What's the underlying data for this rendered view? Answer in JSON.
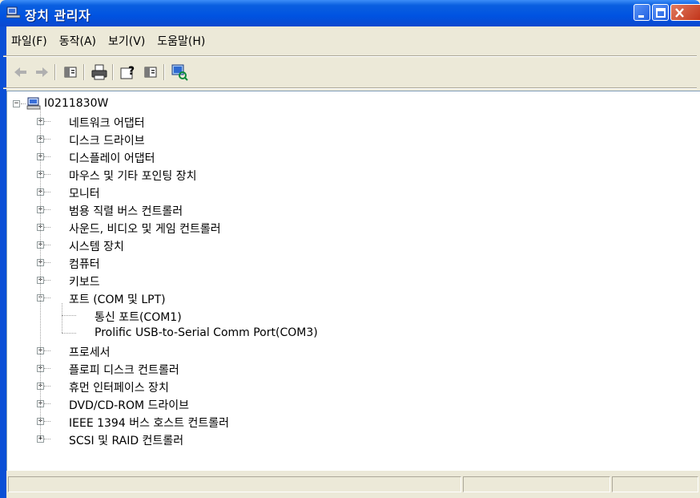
{
  "window": {
    "title": "장치 관리자"
  },
  "menu": [
    {
      "label": "파일(F)",
      "accel": "F"
    },
    {
      "label": "동작(A)",
      "accel": "A"
    },
    {
      "label": "보기(V)",
      "accel": "V"
    },
    {
      "label": "도움말(H)",
      "accel": "H"
    }
  ],
  "menu_labels": {
    "file": "파일(F)",
    "action": "동작(A)",
    "view": "보기(V)",
    "help": "도움말(H)"
  },
  "toolbar": {
    "icons": [
      "back-icon",
      "forward-icon",
      "show-hide-tree-icon",
      "print-icon",
      "help-icon",
      "properties-icon",
      "scan-hardware-icon"
    ]
  },
  "tree": {
    "root": {
      "label": "I0211830W",
      "icon": "computer-icon",
      "expanded": true
    },
    "categories": [
      {
        "label": "네트워크 어댑터",
        "icon": "network-adapter-icon",
        "expanded": false
      },
      {
        "label": "디스크 드라이브",
        "icon": "disk-drive-icon",
        "expanded": false
      },
      {
        "label": "디스플레이 어댑터",
        "icon": "display-adapter-icon",
        "expanded": false
      },
      {
        "label": "마우스 및 기타 포인팅 장치",
        "icon": "mouse-icon",
        "expanded": false
      },
      {
        "label": "모니터",
        "icon": "monitor-icon",
        "expanded": false
      },
      {
        "label": "범용 직렬 버스 컨트롤러",
        "icon": "usb-icon",
        "expanded": false
      },
      {
        "label": "사운드, 비디오 및 게임 컨트롤러",
        "icon": "sound-icon",
        "expanded": false
      },
      {
        "label": "시스템 장치",
        "icon": "system-device-icon",
        "expanded": false
      },
      {
        "label": "컴퓨터",
        "icon": "computer-category-icon",
        "expanded": false
      },
      {
        "label": "키보드",
        "icon": "keyboard-icon",
        "expanded": false
      },
      {
        "label": "포트 (COM 및 LPT)",
        "icon": "port-icon",
        "expanded": true,
        "children": [
          {
            "label": "통신 포트(COM1)",
            "icon": "port-icon"
          },
          {
            "label": "Prolific USB-to-Serial Comm Port(COM3)",
            "icon": "port-icon"
          }
        ]
      },
      {
        "label": "프로세서",
        "icon": "processor-icon",
        "expanded": false
      },
      {
        "label": "플로피 디스크 컨트롤러",
        "icon": "floppy-controller-icon",
        "expanded": false
      },
      {
        "label": "휴먼 인터페이스 장치",
        "icon": "hid-icon",
        "expanded": false
      },
      {
        "label": "DVD/CD-ROM 드라이브",
        "icon": "cdrom-icon",
        "expanded": false
      },
      {
        "label": "IEEE 1394 버스 호스트 컨트롤러",
        "icon": "ieee1394-icon",
        "expanded": false
      },
      {
        "label": "SCSI 및 RAID 컨트롤러",
        "icon": "scsi-icon",
        "expanded": false
      }
    ]
  },
  "colors": {
    "titlebar": "#0053e1",
    "window_bg": "#ece9d8",
    "tree_bg": "#ffffff"
  }
}
